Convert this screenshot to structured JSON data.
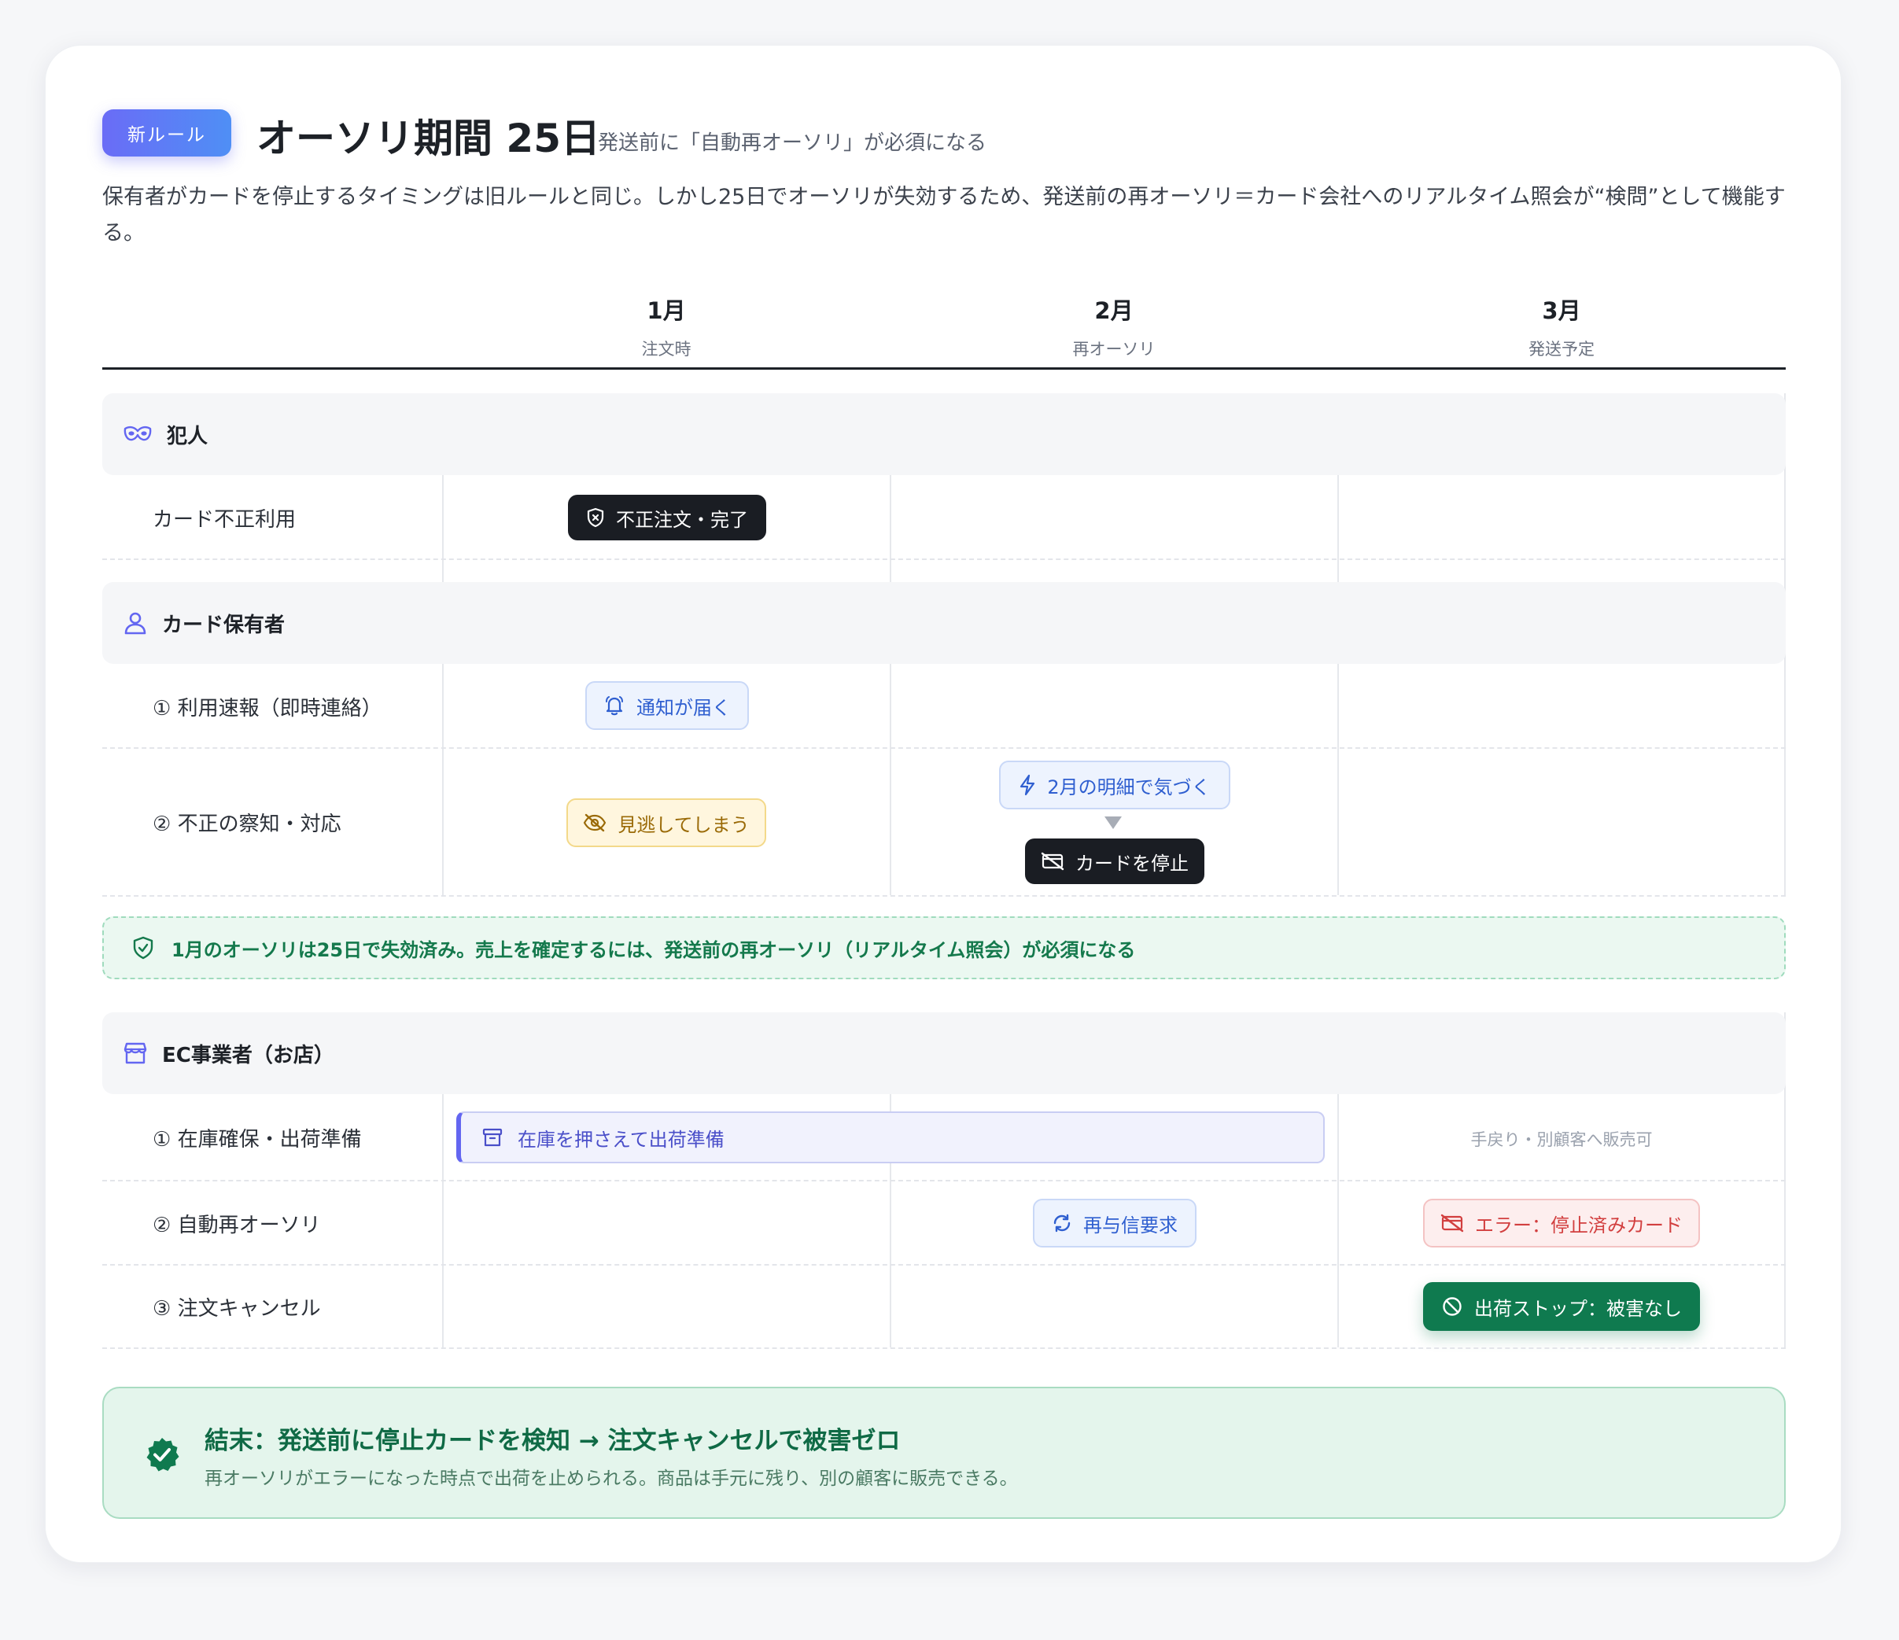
{
  "header": {
    "badge": "新ルール",
    "title": "オーソリ期間 25日",
    "subtitle": "発送前に「自動再オーソリ」が必須になる",
    "description": "保有者がカードを停止するタイミングは旧ルールと同じ。しかし25日でオーソリが失効するため、発送前の再オーソリ＝カード会社へのリアルタイム照会が“検問”として機能する。"
  },
  "columns": [
    {
      "month": "1月",
      "sub": "注文時"
    },
    {
      "month": "2月",
      "sub": "再オーソリ"
    },
    {
      "month": "3月",
      "sub": "発送予定"
    }
  ],
  "sections": {
    "criminal": {
      "label": "犯人",
      "icon": "mask-icon",
      "rows": [
        {
          "label": "カード不正利用",
          "jan": "不正注文・完了"
        }
      ]
    },
    "holder": {
      "label": "カード保有者",
      "icon": "user-icon",
      "rows": [
        {
          "label": "① 利用速報（即時連絡）",
          "jan": "通知が届く"
        },
        {
          "label": "② 不正の察知・対応",
          "jan": "見逃してしまう",
          "feb_top": "2月の明細で気づく",
          "feb_bottom": "カードを停止"
        }
      ]
    },
    "note": "1月のオーソリは25日で失効済み。売上を確定するには、発送前の再オーソリ（リアルタイム照会）が必須になる",
    "merchant": {
      "label": "EC事業者（お店）",
      "icon": "store-icon",
      "rows": [
        {
          "label": "① 在庫確保・出荷準備",
          "span": "在庫を押さえて出荷準備",
          "mar": "手戻り・別顧客へ販売可"
        },
        {
          "label": "② 自動再オーソリ",
          "feb": "再与信要求",
          "mar": "エラー：停止済みカード"
        },
        {
          "label": "③ 注文キャンセル",
          "mar": "出荷ストップ：被害なし"
        }
      ]
    }
  },
  "conclusion": {
    "title": "結末：発送前に停止カードを検知 → 注文キャンセルで被害ゼロ",
    "description": "再オーソリがエラーになった時点で出荷を止められる。商品は手元に残り、別の顧客に販売できる。"
  },
  "colors": {
    "accent": "#6366f1",
    "dark": "#1a1d23",
    "blue": "#2f5fd0",
    "yellow": "#9a6a07",
    "red": "#d23f3f",
    "green": "#0f7a4f"
  }
}
